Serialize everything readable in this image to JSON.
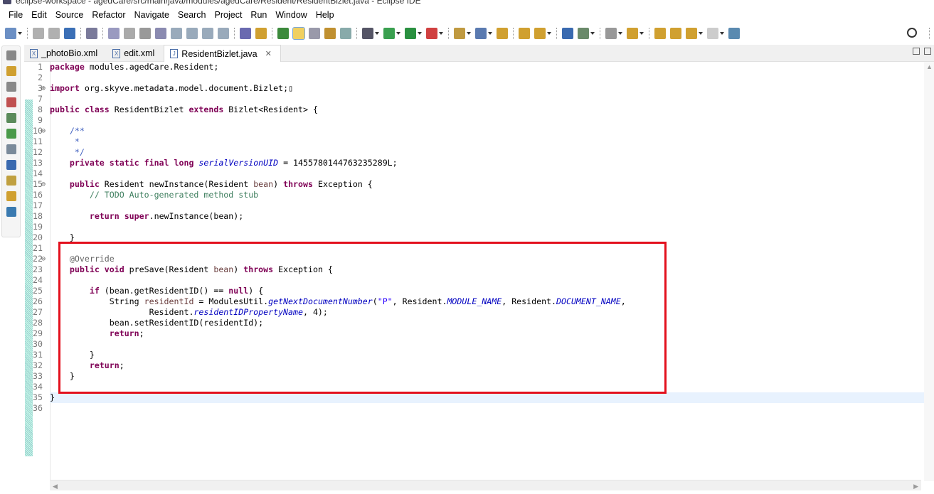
{
  "window": {
    "title": "eclipse-workspace - agedCare/src/main/java/modules/agedCare/Resident/ResidentBizlet.java - Eclipse IDE"
  },
  "menu": [
    "File",
    "Edit",
    "Source",
    "Refactor",
    "Navigate",
    "Search",
    "Project",
    "Run",
    "Window",
    "Help"
  ],
  "toolbar_icons": [
    "new-icon",
    "save-icon",
    "save-all-icon",
    "terminal-icon",
    "skip-breakpoints-icon",
    "resume-icon",
    "suspend-icon",
    "terminate-icon",
    "disconnect-icon",
    "step-into-icon",
    "step-over-icon",
    "step-return-icon",
    "drop-to-frame-icon",
    "use-step-filters-icon",
    "open-type-icon",
    "mark-occurrences-icon",
    "toggle-block-selection-icon",
    "open-task-icon",
    "show-source-icon",
    "show-whitespace-icon",
    "debug-icon",
    "run-icon",
    "coverage-icon",
    "external-tools-icon",
    "new-java-class-icon",
    "spring-icon",
    "open-folder-icon",
    "open-project-icon",
    "deploy-icon",
    "globe-icon",
    "build-icon",
    "annotation-nav-icon",
    "next-annotation-icon",
    "prev-annotation-icon",
    "last-edit-icon",
    "back-icon",
    "forward-icon",
    "open-perspective-icon"
  ],
  "colors": {
    "highlight_box": "#e3101d",
    "keyword": "#7f0055",
    "comment": "#3f7f5f",
    "string": "#2a00ff",
    "field": "#0000c0"
  },
  "tabs": [
    {
      "label": "_photoBio.xml",
      "icon": "X",
      "active": false
    },
    {
      "label": "edit.xml",
      "icon": "X",
      "active": false
    },
    {
      "label": "ResidentBizlet.java",
      "icon": "J",
      "active": true,
      "close": "✕"
    }
  ],
  "code": [
    {
      "n": "1",
      "t": [
        [
          "kw",
          "package"
        ],
        [
          "pl",
          " modules.agedCare.Resident;"
        ]
      ]
    },
    {
      "n": "2",
      "t": []
    },
    {
      "n": "3",
      "fold": "⊕",
      "t": [
        [
          "kw",
          "import"
        ],
        [
          "pl",
          " org.skyve.metadata.model.document.Bizlet;"
        ],
        [
          "pl",
          "▯"
        ]
      ]
    },
    {
      "n": "7",
      "t": []
    },
    {
      "n": "8",
      "t": [
        [
          "kw",
          "public class"
        ],
        [
          "pl",
          " ResidentBizlet "
        ],
        [
          "kw",
          "extends"
        ],
        [
          "pl",
          " Bizlet<Resident> "
        ],
        [
          "pl",
          "{"
        ]
      ]
    },
    {
      "n": "9",
      "t": []
    },
    {
      "n": "10",
      "fold": "⊖",
      "t": [
        [
          "doc",
          "    /**"
        ]
      ]
    },
    {
      "n": "11",
      "t": [
        [
          "doc",
          "     *"
        ]
      ]
    },
    {
      "n": "12",
      "t": [
        [
          "doc",
          "     */"
        ]
      ]
    },
    {
      "n": "13",
      "t": [
        [
          "pl",
          "    "
        ],
        [
          "kw",
          "private static final long"
        ],
        [
          "pl",
          " "
        ],
        [
          "fld",
          "serialVersionUID"
        ],
        [
          "pl",
          " = 1455780144763235289L;"
        ]
      ]
    },
    {
      "n": "14",
      "t": []
    },
    {
      "n": "15",
      "fold": "⊖",
      "t": [
        [
          "pl",
          "    "
        ],
        [
          "kw",
          "public"
        ],
        [
          "pl",
          " Resident newInstance(Resident "
        ],
        [
          "var",
          "bean"
        ],
        [
          "pl",
          ") "
        ],
        [
          "kw",
          "throws"
        ],
        [
          "pl",
          " Exception {"
        ]
      ]
    },
    {
      "n": "16",
      "t": [
        [
          "com",
          "        // TODO Auto-generated method stub"
        ]
      ]
    },
    {
      "n": "17",
      "t": []
    },
    {
      "n": "18",
      "t": [
        [
          "pl",
          "        "
        ],
        [
          "kw",
          "return super"
        ],
        [
          "pl",
          ".newInstance(bean);"
        ]
      ]
    },
    {
      "n": "19",
      "t": []
    },
    {
      "n": "20",
      "t": [
        [
          "pl",
          "    }"
        ]
      ]
    },
    {
      "n": "21",
      "t": []
    },
    {
      "n": "22",
      "fold": "⊖",
      "t": [
        [
          "ann",
          "    @Override"
        ]
      ]
    },
    {
      "n": "23",
      "t": [
        [
          "pl",
          "    "
        ],
        [
          "kw",
          "public void"
        ],
        [
          "pl",
          " preSave(Resident "
        ],
        [
          "var",
          "bean"
        ],
        [
          "pl",
          ") "
        ],
        [
          "kw",
          "throws"
        ],
        [
          "pl",
          " Exception {"
        ]
      ]
    },
    {
      "n": "24",
      "t": []
    },
    {
      "n": "25",
      "t": [
        [
          "pl",
          "        "
        ],
        [
          "kw",
          "if"
        ],
        [
          "pl",
          " (bean.getResidentID() == "
        ],
        [
          "kw",
          "null"
        ],
        [
          "pl",
          ") {"
        ]
      ]
    },
    {
      "n": "26",
      "t": [
        [
          "pl",
          "            String "
        ],
        [
          "var",
          "residentId"
        ],
        [
          "pl",
          " = ModulesUtil."
        ],
        [
          "fld",
          "getNextDocumentNumber"
        ],
        [
          "pl",
          "("
        ],
        [
          "str",
          "\"P\""
        ],
        [
          "pl",
          ", Resident."
        ],
        [
          "fld",
          "MODULE_NAME"
        ],
        [
          "pl",
          ", Resident."
        ],
        [
          "fld",
          "DOCUMENT_NAME"
        ],
        [
          "pl",
          ","
        ]
      ]
    },
    {
      "n": "27",
      "t": [
        [
          "pl",
          "                    Resident."
        ],
        [
          "fld",
          "residentIDPropertyName"
        ],
        [
          "pl",
          ", 4);"
        ]
      ]
    },
    {
      "n": "28",
      "t": [
        [
          "pl",
          "            bean.setResidentID(residentId);"
        ]
      ]
    },
    {
      "n": "29",
      "t": [
        [
          "pl",
          "            "
        ],
        [
          "kw",
          "return"
        ],
        [
          "pl",
          ";"
        ]
      ]
    },
    {
      "n": "30",
      "t": []
    },
    {
      "n": "31",
      "t": [
        [
          "pl",
          "        }"
        ]
      ]
    },
    {
      "n": "32",
      "t": [
        [
          "pl",
          "        "
        ],
        [
          "kw",
          "return"
        ],
        [
          "pl",
          ";"
        ]
      ]
    },
    {
      "n": "33",
      "t": [
        [
          "pl",
          "    }"
        ]
      ]
    },
    {
      "n": "34",
      "t": []
    },
    {
      "n": "35",
      "current": true,
      "t": [
        [
          "pl",
          "}"
        ]
      ]
    },
    {
      "n": "36",
      "t": []
    }
  ]
}
